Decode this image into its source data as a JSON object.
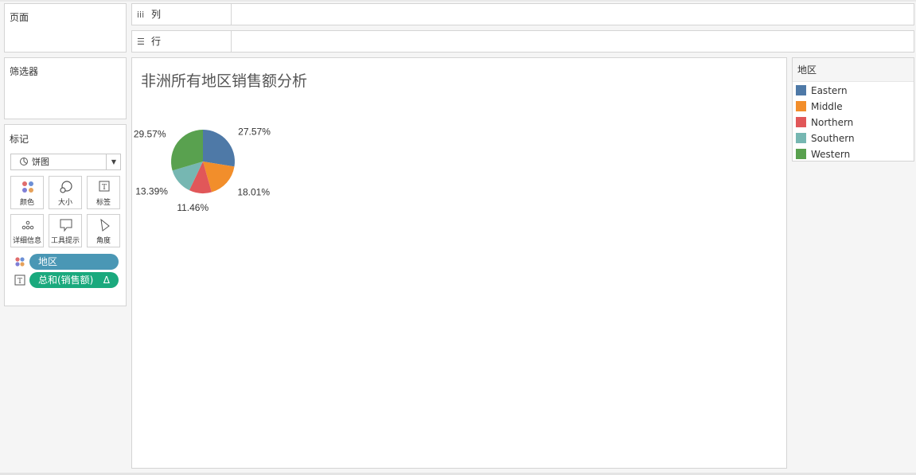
{
  "cards": {
    "pages": "页面",
    "filters": "筛选器",
    "marks": "标记"
  },
  "shelves": {
    "columns": "列",
    "rows": "行"
  },
  "marks": {
    "type": "饼图",
    "buttons": [
      "颜色",
      "大小",
      "标签",
      "详细信息",
      "工具提示",
      "角度"
    ],
    "pills": [
      {
        "label": "地区",
        "color": "#4a97b5"
      },
      {
        "label": "总和(销售额)",
        "color": "#1aa97d",
        "suffix": "Δ"
      }
    ]
  },
  "legend": {
    "title": "地区",
    "items": [
      {
        "name": "Eastern",
        "color": "#4e79a7"
      },
      {
        "name": "Middle",
        "color": "#f28e2b"
      },
      {
        "name": "Northern",
        "color": "#e15759"
      },
      {
        "name": "Southern",
        "color": "#76b7b2"
      },
      {
        "name": "Western",
        "color": "#59a14f"
      }
    ]
  },
  "chart_data": {
    "type": "pie",
    "title": "非洲所有地区销售额分析",
    "categories": [
      "Eastern",
      "Middle",
      "Northern",
      "Southern",
      "Western"
    ],
    "values": [
      27.57,
      18.01,
      11.46,
      13.39,
      29.57
    ],
    "labels": [
      "27.57%",
      "18.01%",
      "11.46%",
      "13.39%",
      "29.57%"
    ],
    "colors": [
      "#4e79a7",
      "#f28e2b",
      "#e15759",
      "#76b7b2",
      "#59a14f"
    ],
    "legend": "right"
  }
}
